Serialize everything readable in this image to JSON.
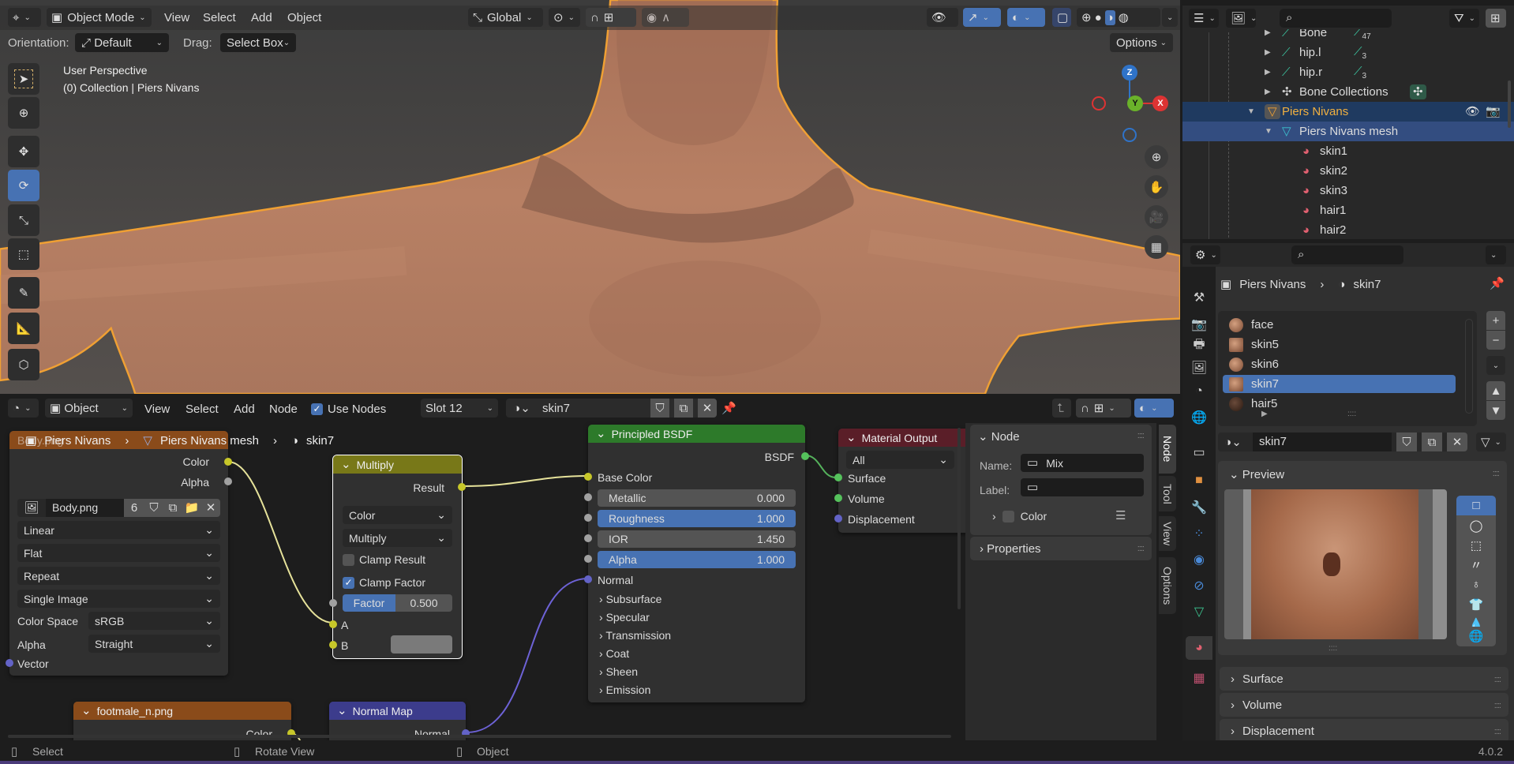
{
  "viewport": {
    "header": {
      "mode": "Object Mode",
      "menus": [
        "View",
        "Select",
        "Add",
        "Object"
      ],
      "transform_orientation": "Global",
      "options_label": "Options"
    },
    "tool_settings": {
      "orientation_label": "Orientation:",
      "orientation_value": "Default",
      "drag_label": "Drag:",
      "drag_value": "Select Box"
    },
    "overlay": {
      "view_name": "User Perspective",
      "collection_line": "(0) Collection | Piers Nivans"
    },
    "gizmo": {
      "z": "Z",
      "y": "Y",
      "x": "X"
    },
    "tools": [
      "select-box",
      "cursor",
      "move",
      "rotate",
      "scale",
      "transform",
      "annotate",
      "measure",
      "add-cube"
    ],
    "active_tool": "rotate",
    "colors": {
      "outline": "#f0a033",
      "skin": "#b27b5e",
      "active": "#4772b3"
    }
  },
  "node_editor": {
    "header": {
      "editor_mode": "Object",
      "menus": [
        "View",
        "Select",
        "Add",
        "Node"
      ],
      "use_nodes_label": "Use Nodes",
      "use_nodes": true,
      "slot": "Slot 12",
      "material": "skin7"
    },
    "breadcrumb": [
      "Piers Nivans",
      "Piers Nivans mesh",
      "skin7"
    ],
    "image_node": {
      "title_partial": "Body.png",
      "outputs": [
        "Color",
        "Alpha"
      ],
      "image": "Body.png",
      "users": "6",
      "interpolation": "Linear",
      "projection": "Flat",
      "extension": "Repeat",
      "source": "Single Image",
      "color_space_label": "Color Space",
      "color_space": "sRGB",
      "alpha_label": "Alpha",
      "alpha": "Straight",
      "input": "Vector"
    },
    "multiply_node": {
      "title": "Multiply",
      "output": "Result",
      "data_type": "Color",
      "blend": "Multiply",
      "clamp_result_label": "Clamp Result",
      "clamp_result": false,
      "clamp_factor_label": "Clamp Factor",
      "clamp_factor": true,
      "factor_label": "Factor",
      "factor_value": "0.500",
      "inputs": [
        "A",
        "B"
      ]
    },
    "principled_node": {
      "title": "Principled BSDF",
      "output": "BSDF",
      "base_color": "Base Color",
      "fields": [
        {
          "label": "Metallic",
          "value": "0.000",
          "highlight": false
        },
        {
          "label": "Roughness",
          "value": "1.000",
          "highlight": true
        },
        {
          "label": "IOR",
          "value": "1.450",
          "highlight": false
        },
        {
          "label": "Alpha",
          "value": "1.000",
          "highlight": true
        }
      ],
      "normal": "Normal",
      "panels": [
        "Subsurface",
        "Specular",
        "Transmission",
        "Coat",
        "Sheen",
        "Emission"
      ]
    },
    "output_node": {
      "title": "Material Output",
      "target": "All",
      "inputs": [
        "Surface",
        "Volume",
        "Displacement"
      ]
    },
    "footmale_node": {
      "title": "footmale_n.png",
      "output": "Color"
    },
    "normalmap_node": {
      "title": "Normal Map",
      "output": "Normal"
    },
    "sidebar": {
      "panel_title": "Node",
      "name_label": "Name:",
      "name_value": "Mix",
      "label_label": "Label:",
      "label_value": "",
      "color_label": "Color",
      "properties_label": "Properties",
      "tabs": [
        "Node",
        "Tool",
        "View",
        "Options"
      ],
      "active_tab": "Node"
    }
  },
  "outliner": {
    "rows": [
      {
        "label": "Bone",
        "badge": "47",
        "depth": 2,
        "icon": "bone-icon",
        "partial": true
      },
      {
        "label": "hip.l",
        "badge": "3",
        "depth": 2,
        "icon": "bone-icon"
      },
      {
        "label": "hip.r",
        "badge": "3",
        "depth": 2,
        "icon": "bone-icon"
      },
      {
        "label": "Bone Collections",
        "depth": 2,
        "icon": "bone-collections-icon"
      },
      {
        "label": "Piers Nivans",
        "depth": 1,
        "icon": "mesh-object-icon",
        "selected": true
      },
      {
        "label": "Piers Nivans mesh",
        "depth": 2,
        "icon": "mesh-data-icon",
        "highlighted": true
      },
      {
        "label": "skin1",
        "depth": 3,
        "icon": "material-icon"
      },
      {
        "label": "skin2",
        "depth": 3,
        "icon": "material-icon"
      },
      {
        "label": "skin3",
        "depth": 3,
        "icon": "material-icon"
      },
      {
        "label": "hair1",
        "depth": 3,
        "icon": "material-icon"
      },
      {
        "label": "hair2",
        "depth": 3,
        "icon": "material-icon"
      }
    ]
  },
  "properties": {
    "breadcrumb": [
      "Piers Nivans",
      "skin7"
    ],
    "material_slots": [
      {
        "name": "face",
        "selected": false
      },
      {
        "name": "skin5",
        "selected": false
      },
      {
        "name": "skin6",
        "selected": false
      },
      {
        "name": "skin7",
        "selected": true
      },
      {
        "name": "hair5",
        "selected": false
      }
    ],
    "material_name": "skin7",
    "preview_label": "Preview",
    "preview_shapes": [
      "flat",
      "sphere",
      "cube",
      "hair",
      "shader-ball",
      "cloth",
      "fluid"
    ],
    "panels": [
      "Surface",
      "Volume",
      "Displacement"
    ],
    "tabs": [
      "tool",
      "render",
      "output",
      "view-layer",
      "scene",
      "world",
      "collection",
      "object",
      "modifiers",
      "particles",
      "physics",
      "constraints",
      "data",
      "material",
      "texture"
    ],
    "active_tab": "material"
  },
  "status_bar": {
    "hints": [
      "Select",
      "Rotate View",
      "Object"
    ],
    "version": "4.0.2"
  }
}
